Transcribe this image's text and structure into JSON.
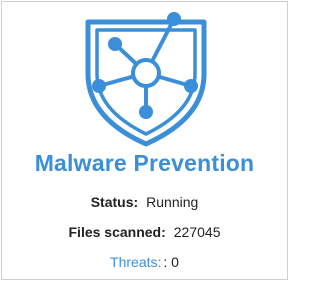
{
  "widget": {
    "title": "Malware Prevention",
    "icon": "shield-network-icon",
    "accent_color": "#3b8fd9",
    "status": {
      "label": "Status:",
      "value": "Running"
    },
    "files_scanned": {
      "label": "Files scanned:",
      "value": "227045"
    },
    "threats": {
      "label": "Threats:",
      "value": ": 0"
    }
  }
}
